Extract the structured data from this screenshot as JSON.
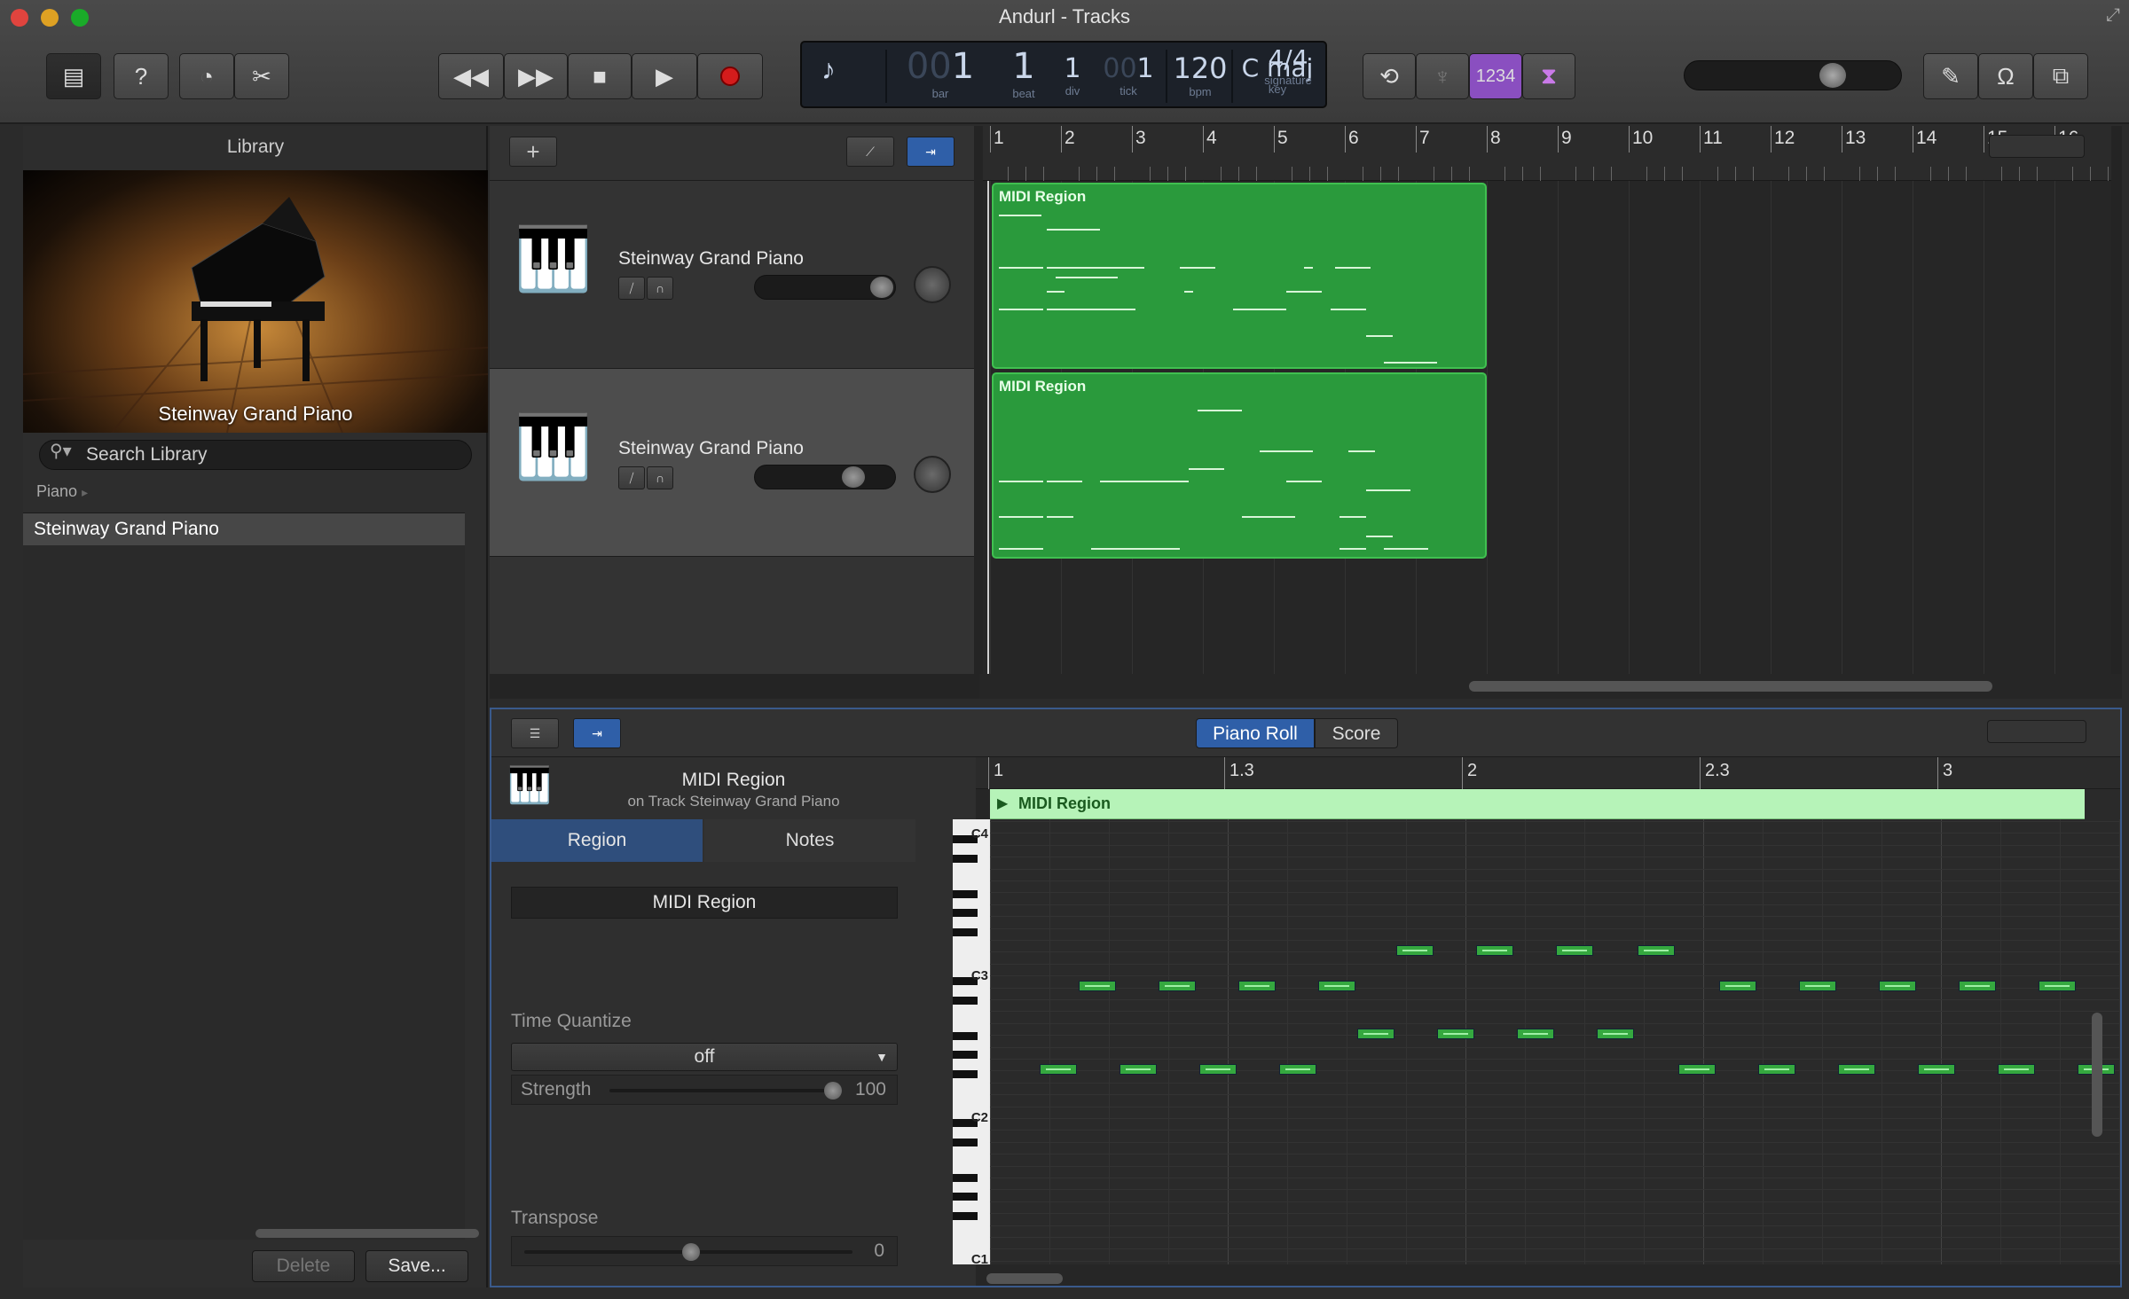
{
  "window": {
    "title": "Andurl - Tracks"
  },
  "lcd": {
    "bar": "1",
    "bar_dim": "00",
    "bar_label": "bar",
    "beat": "1",
    "beat_label": "beat",
    "div": "1",
    "div_label": "div",
    "tick": "1",
    "tick_dim": "00",
    "tick_label": "tick",
    "bpm": "120",
    "bpm_label": "bpm",
    "key": "C maj",
    "key_label": "key",
    "signature": "4/4",
    "signature_label": "signature",
    "count_in": "1234"
  },
  "library": {
    "title": "Library",
    "image_label": "Steinway Grand Piano",
    "search_placeholder": "Search Library",
    "crumb": "Piano",
    "items": [
      "Steinway Grand Piano"
    ],
    "delete_label": "Delete",
    "save_label": "Save..."
  },
  "tracks": [
    {
      "name": "Steinway Grand Piano",
      "region_label": "MIDI Region",
      "volume": 0.85
    },
    {
      "name": "Steinway Grand Piano",
      "region_label": "MIDI Region",
      "volume": 0.7
    }
  ],
  "ruler": {
    "numbers": [
      "1",
      "2",
      "3",
      "4",
      "5",
      "6",
      "7",
      "8",
      "9",
      "10",
      "11",
      "12",
      "13",
      "14",
      "15",
      "16"
    ]
  },
  "editor": {
    "tab_piano_roll": "Piano Roll",
    "tab_score": "Score",
    "region_title": "MIDI Region",
    "region_sub": "on Track Steinway Grand Piano",
    "inspector_tab_region": "Region",
    "inspector_tab_notes": "Notes",
    "region_name": "MIDI Region",
    "time_quantize_label": "Time Quantize",
    "time_quantize_value": "off",
    "strength_label": "Strength",
    "strength_value": "100",
    "transpose_label": "Transpose",
    "transpose_value": "0",
    "pr_ruler": [
      "1",
      "1.3",
      "2",
      "2.3",
      "3"
    ],
    "region_bar_label": "MIDI Region",
    "key_labels": [
      "C4",
      "C3",
      "C2",
      "C1"
    ]
  },
  "colors": {
    "region_green": "#2a9a3c",
    "pr_region_light": "#b6f3b8",
    "accent_blue": "#3a5a8c",
    "count_in_purple": "#8a4fc0"
  }
}
